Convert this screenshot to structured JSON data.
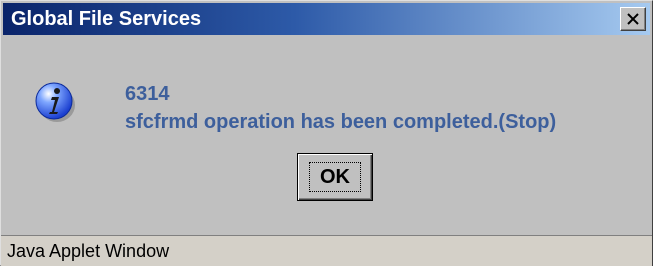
{
  "window": {
    "title": "Global File Services",
    "close_icon": "close-icon"
  },
  "dialog": {
    "icon": "information-icon",
    "message_code": "6314",
    "message_text": "sfcfrmd operation has been completed.(Stop)",
    "ok_label": "OK"
  },
  "statusbar": {
    "text": "Java Applet Window"
  },
  "colors": {
    "title_start": "#0a246a",
    "title_end": "#a6caf0",
    "message_text": "#3d5f9c",
    "dialog_bg": "#c0c0c0"
  }
}
